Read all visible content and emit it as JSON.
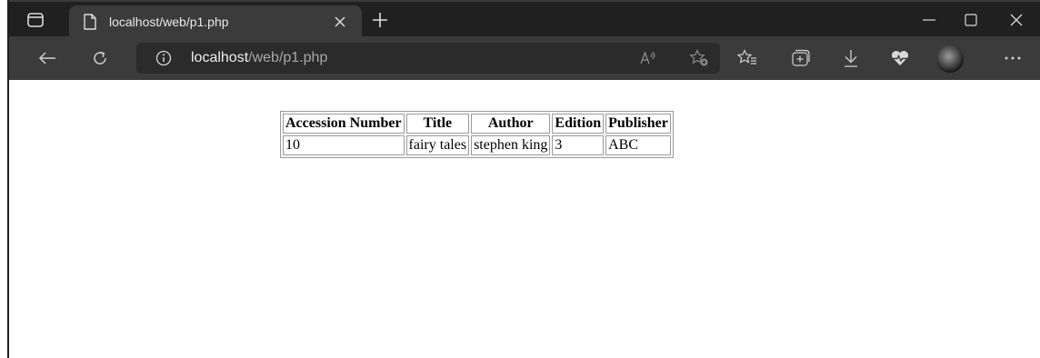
{
  "browser": {
    "tab": {
      "title": "localhost/web/p1.php"
    },
    "address": {
      "host": "localhost",
      "path": "/web/p1.php"
    },
    "icons": {
      "tab_actions": "tab-actions-icon",
      "page": "page-icon",
      "close_tab": "close-icon",
      "new_tab": "plus-icon",
      "minimize": "minimize-icon",
      "maximize": "maximize-icon",
      "close_window": "close-icon",
      "back": "back-arrow-icon",
      "refresh": "refresh-icon",
      "site_info": "info-icon",
      "read_aloud": "read-aloud-icon",
      "add_favorite": "add-favorite-icon",
      "favorites": "favorites-icon",
      "collections": "collections-icon",
      "downloads": "download-icon",
      "health": "browser-essentials-icon",
      "more": "more-icon"
    },
    "colors": {
      "tabbar": "#202020",
      "toolbar": "#3b3b3b",
      "address_bg": "#2b2b2b"
    }
  },
  "page": {
    "table": {
      "headers": [
        "Accession Number",
        "Title",
        "Author",
        "Edition",
        "Publisher"
      ],
      "rows": [
        [
          "10",
          "fairy tales",
          "stephen king",
          "3",
          "ABC"
        ]
      ]
    }
  }
}
